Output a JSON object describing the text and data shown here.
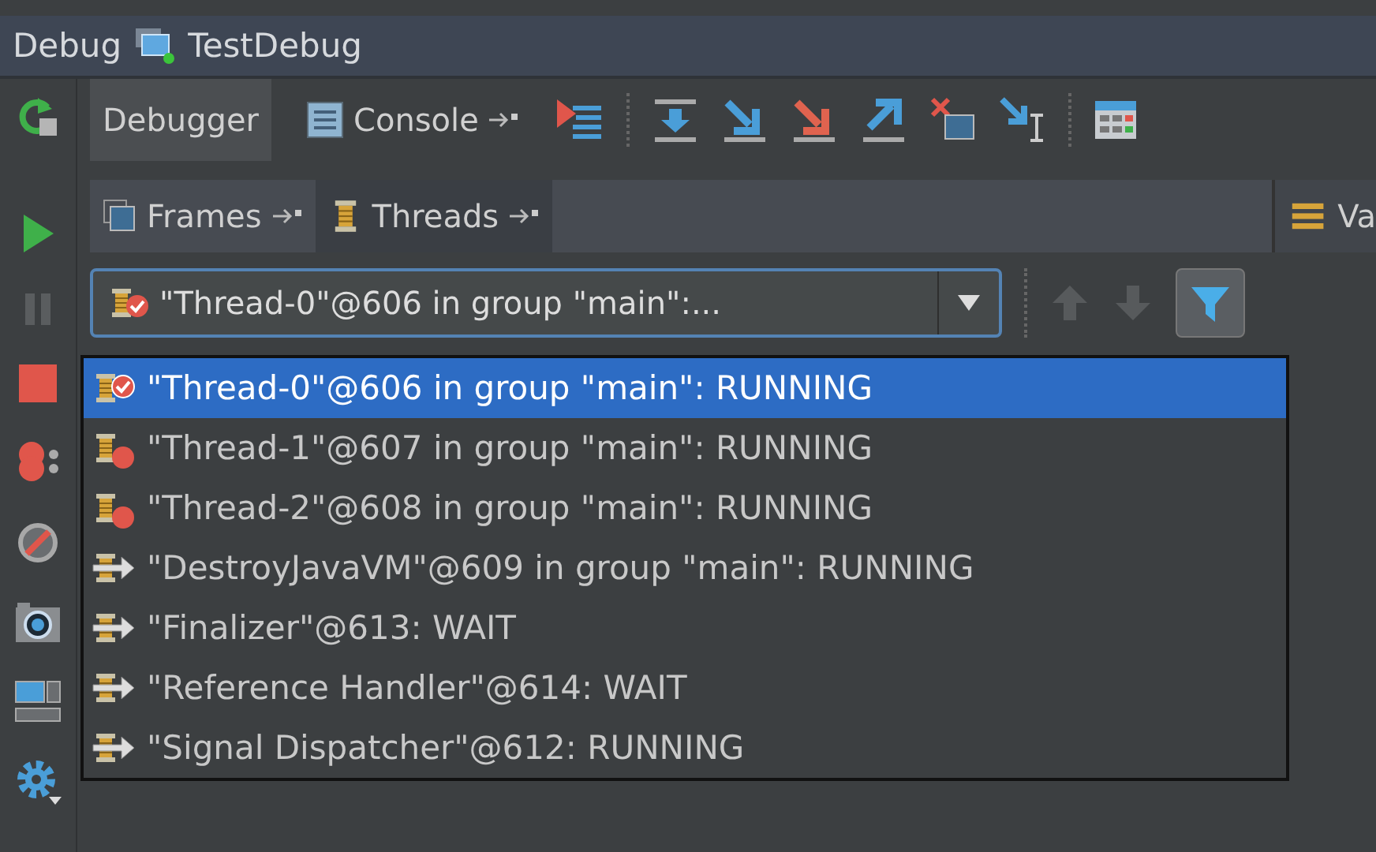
{
  "window": {
    "title": "Debug",
    "config": "TestDebug"
  },
  "tabs": [
    {
      "label": "Debugger",
      "selected": true,
      "pin": false
    },
    {
      "label": "Console",
      "selected": false,
      "pin": true
    }
  ],
  "subtabs": [
    {
      "label": "Frames",
      "selected": false
    },
    {
      "label": "Threads",
      "selected": true
    }
  ],
  "side_tab": {
    "label": "Va"
  },
  "thread_combo": {
    "value": "\"Thread-0\"@606 in group \"main\":..."
  },
  "nav": {
    "up_disabled": true,
    "down_disabled": true,
    "filter_on": true
  },
  "threads": [
    {
      "kind": "current",
      "label": "\"Thread-0\"@606 in group \"main\": RUNNING",
      "selected": true
    },
    {
      "kind": "breakpoint",
      "label": "\"Thread-1\"@607 in group \"main\": RUNNING",
      "selected": false
    },
    {
      "kind": "breakpoint",
      "label": "\"Thread-2\"@608 in group \"main\": RUNNING",
      "selected": false
    },
    {
      "kind": "running",
      "label": "\"DestroyJavaVM\"@609 in group \"main\": RUNNING",
      "selected": false
    },
    {
      "kind": "running",
      "label": "\"Finalizer\"@613: WAIT",
      "selected": false
    },
    {
      "kind": "running",
      "label": "\"Reference Handler\"@614: WAIT",
      "selected": false
    },
    {
      "kind": "running",
      "label": "\"Signal Dispatcher\"@612: RUNNING",
      "selected": false
    }
  ]
}
